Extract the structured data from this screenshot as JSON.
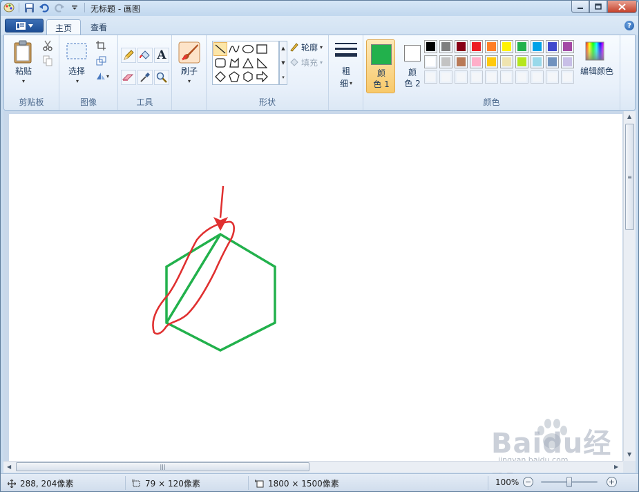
{
  "window": {
    "title": "无标题 - 画图"
  },
  "tabs": {
    "file_menu_icon": "menu-icon",
    "items": [
      {
        "label": "主页",
        "active": true
      },
      {
        "label": "查看",
        "active": false
      }
    ],
    "help": "?"
  },
  "ribbon": {
    "clipboard": {
      "paste_label": "粘贴",
      "group_label": "剪贴板"
    },
    "image": {
      "select_label": "选择",
      "group_label": "图像"
    },
    "tools": {
      "text_tool": "A",
      "group_label": "工具"
    },
    "brushes": {
      "label": "刷子"
    },
    "shapes": {
      "outline_label": "轮廓",
      "fill_label": "填充",
      "group_label": "形状"
    },
    "size": {
      "label_line1": "粗",
      "label_line2": "细"
    },
    "colors": {
      "color1_line1": "颜",
      "color1_line2": "色 1",
      "color2_line1": "颜",
      "color2_line2": "色 2",
      "edit_colors_label": "编辑颜色",
      "group_label": "颜色",
      "color1_value": "#22b14c",
      "color2_value": "#ffffff",
      "palette_row1": [
        "#000000",
        "#7f7f7f",
        "#880015",
        "#ed1c24",
        "#ff7f27",
        "#fff200",
        "#22b14c",
        "#00a2e8",
        "#3f48cc",
        "#a349a4"
      ],
      "palette_row2": [
        "#ffffff",
        "#c3c3c3",
        "#b97a57",
        "#ffaec9",
        "#ffc90e",
        "#efe4b0",
        "#b5e61d",
        "#99d9ea",
        "#7092be",
        "#c8bfe7"
      ],
      "palette_row3_empty": 10
    }
  },
  "drawing": {
    "hexagon_color": "#22b14c",
    "annotation_color": "#e03030"
  },
  "statusbar": {
    "cursor_pos": "288, 204像素",
    "selection_size": "79 × 120像素",
    "image_size": "1800 × 1500像素",
    "zoom": "100%",
    "zoom_level_fraction": 0.5
  },
  "watermark": {
    "logo_text": "Baidu经验",
    "url": "jingyan.baidu.com"
  }
}
